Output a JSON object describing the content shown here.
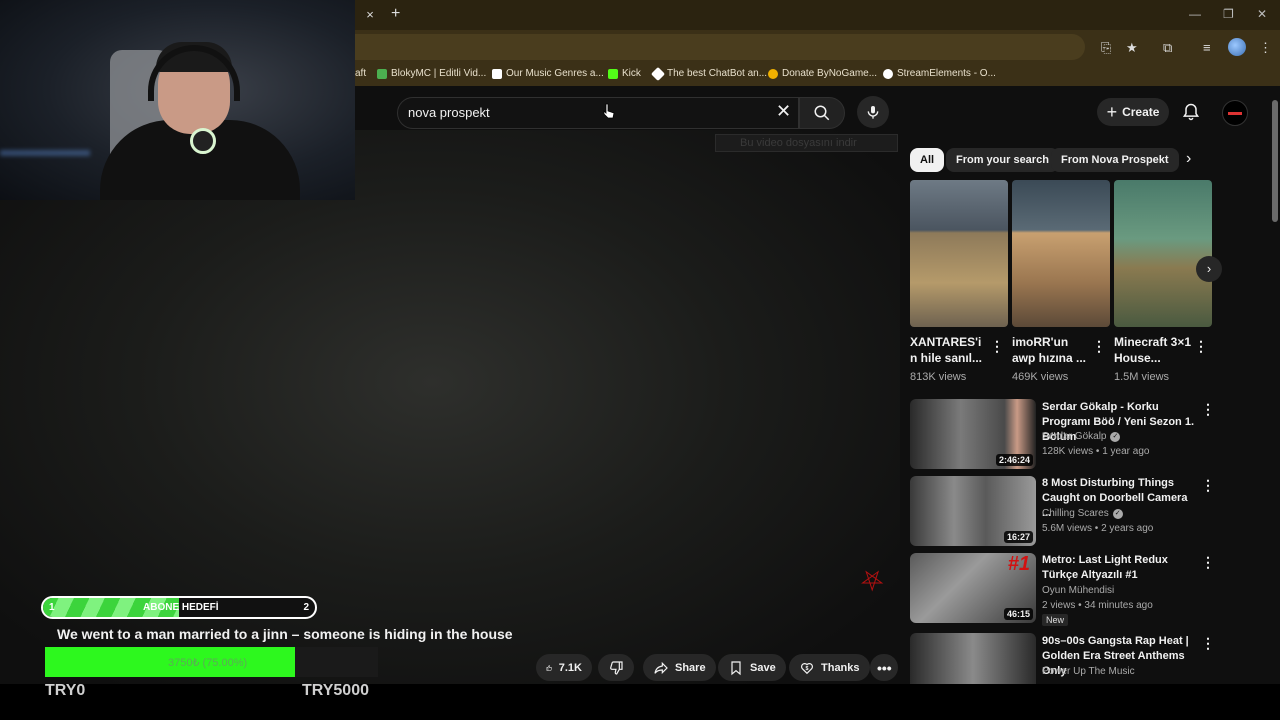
{
  "browser": {
    "tab_close": "×",
    "new_tab": "+",
    "bookmarks": [
      {
        "label": "aft",
        "color": "#3b3017"
      },
      {
        "label": "BlokyMC | Editli Vid...",
        "color": "#4caf50"
      },
      {
        "label": "Our Music Genres a...",
        "color": "#ffffff"
      },
      {
        "label": "Kick",
        "color": "#53fc18"
      },
      {
        "label": "The best ChatBot an...",
        "color": "#ffffff"
      },
      {
        "label": "Donate ByNoGame...",
        "color": "#f0b000"
      },
      {
        "label": "StreamElements - O...",
        "color": "#ffffff"
      }
    ]
  },
  "search": {
    "query": "nova prospekt"
  },
  "header": {
    "create_label": "Create"
  },
  "overlay": {
    "download_bar": "Bu video dosyasını indir"
  },
  "chips": [
    "All",
    "From your search",
    "From Nova Prospekt"
  ],
  "shorts": [
    {
      "title": "XANTARES'i n hile sanıl...",
      "views": "813K views"
    },
    {
      "title": "imoRR'un awp hızına ...",
      "views": "469K views"
    },
    {
      "title": "Minecraft 3×1 House...",
      "views": "1.5M views"
    }
  ],
  "recommended": [
    {
      "title": "Serdar Gökalp - Korku Programı Böö / Yeni Sezon 1. Bölüm",
      "channel": "Serdar Gökalp",
      "verified": true,
      "meta": "128K views • 1 year ago",
      "duration": "2:46:24"
    },
    {
      "title": "8 Most Disturbing Things Caught on Doorbell Camera ...",
      "channel": "Chilling Scares",
      "verified": true,
      "meta": "5.6M views • 2 years ago",
      "duration": "16:27"
    },
    {
      "title": "Metro: Last Light Redux Türkçe Altyazılı #1",
      "channel": "Oyun Mühendisi",
      "verified": false,
      "meta": "2 views • 34 minutes ago",
      "duration": "46:15",
      "badge": "New"
    },
    {
      "title": "90s–00s Gangsta Rap Heat | Golden Era Street Anthems Only",
      "channel": "Power Up The Music",
      "verified": false,
      "meta": "",
      "duration": ""
    }
  ],
  "video": {
    "title": "We went to a man married to a jinn – someone is hiding in the house",
    "likes": "7.1K",
    "share_label": "Share",
    "save_label": "Save",
    "thanks_label": "Thanks"
  },
  "stream": {
    "sub_goal_current": "1",
    "sub_goal_label": "ABONE HEDEFİ",
    "sub_goal_target": "2",
    "sub_goal_progress": 0.5,
    "donation_text": "3750₺ (75.00%)",
    "donation_progress": 0.75,
    "try_min": "TRY0",
    "try_max": "TRY5000"
  },
  "colors": {
    "background": "#0f0f0f",
    "chip_bg": "#272727",
    "goal_green": "#3cd43c",
    "donation_green": "#2df81e",
    "brand_red": "#b31010"
  }
}
